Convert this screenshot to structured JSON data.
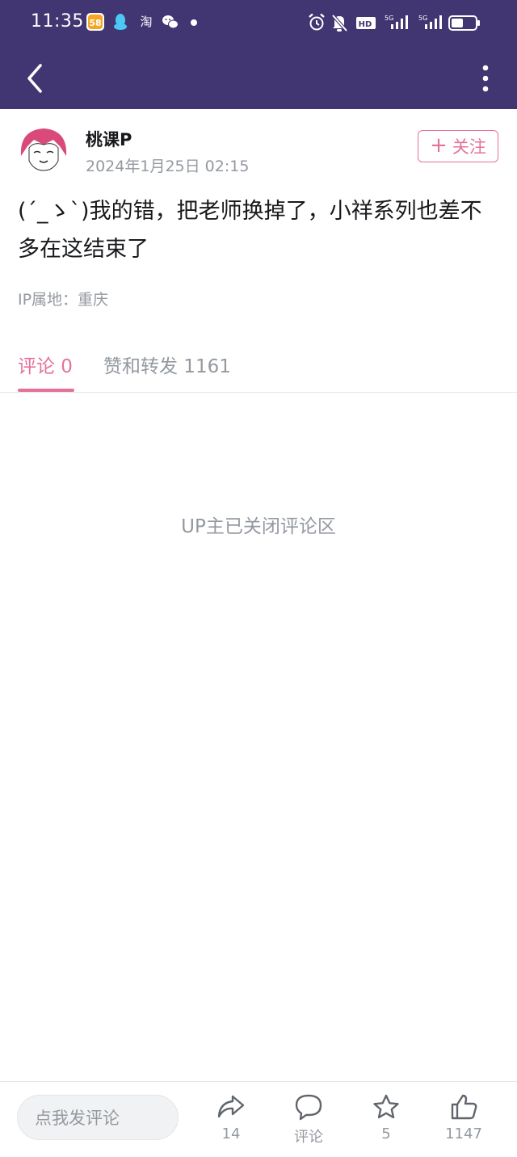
{
  "status_bar": {
    "time": "11:35",
    "app_icons": [
      "58-app-icon",
      "qq-icon",
      "taobao-icon",
      "wechat-icon"
    ],
    "taobao_glyph": "淘",
    "badge_58": "58",
    "right_icons": [
      "alarm-icon",
      "mute-icon",
      "hd-icon",
      "5g-signal-icon",
      "5g-signal-icon",
      "battery-icon"
    ]
  },
  "navbar": {
    "back_icon": "chevron-left-icon",
    "more_icon": "more-vertical-icon"
  },
  "post": {
    "author": "桃课P",
    "time": "2024年1月25日 02:15",
    "follow_label": "关注",
    "follow_plus": "+",
    "text": "(´_ゝ`)我的错，把老师换掉了，小祥系列也差不多在这结束了",
    "ip": "IP属地：重庆"
  },
  "tabs": {
    "comments": "评论 0",
    "likes": "赞和转发 1161"
  },
  "comments_closed": "UP主已关闭评论区",
  "bottom_bar": {
    "input_placeholder": "点我发评论",
    "share_count": "14",
    "comment_label": "评论",
    "favorite_count": "5",
    "like_count": "1147"
  },
  "colors": {
    "header_bg": "#413672",
    "accent_pink": "#e4719c",
    "muted_text": "#9499a0"
  }
}
